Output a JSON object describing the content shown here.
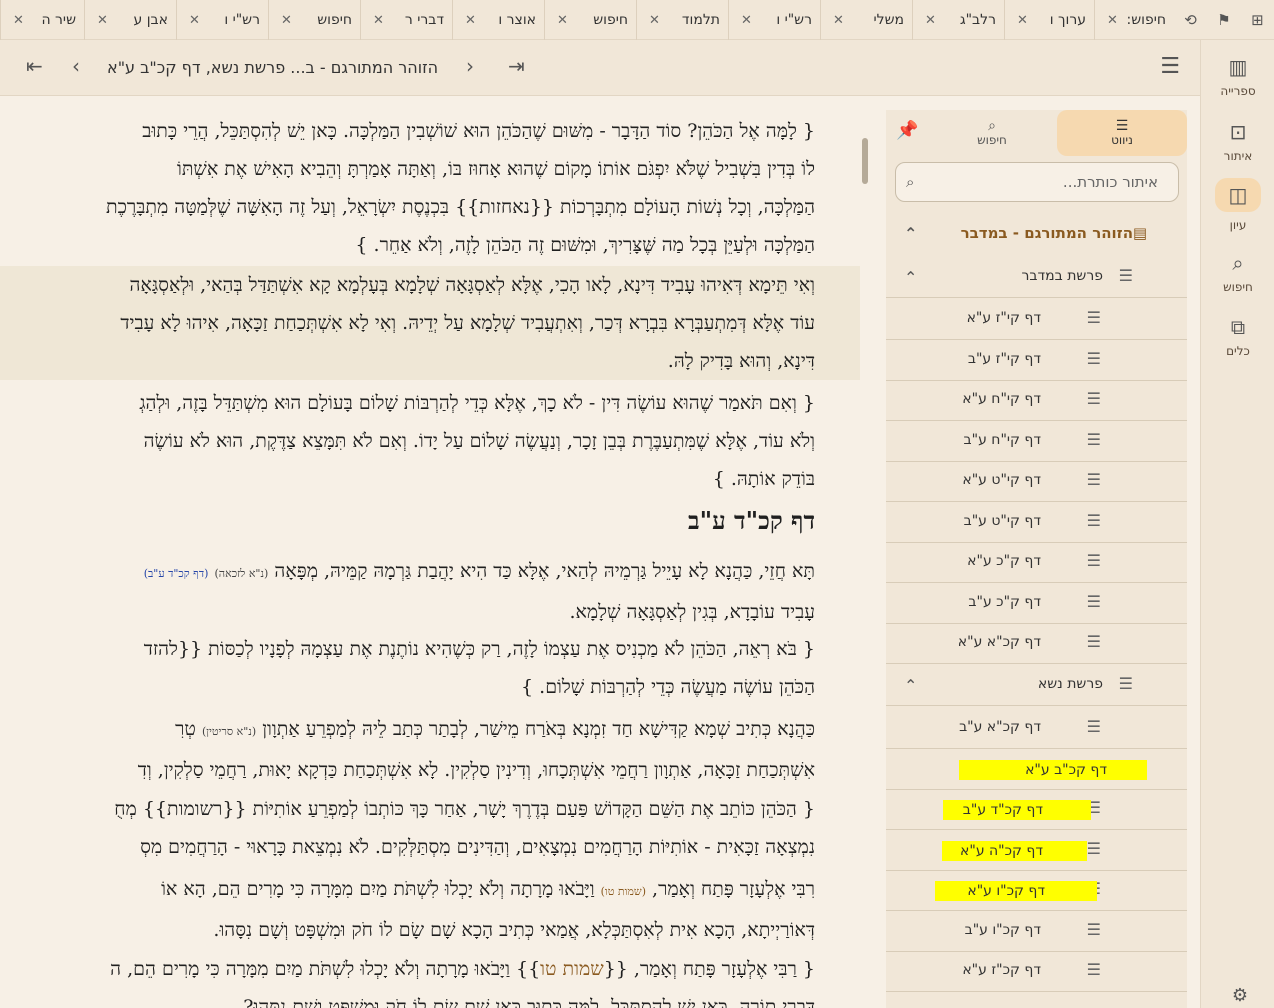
{
  "tabs": [
    {
      "label": "חיפוש:"
    },
    {
      "label": "ערוך ו"
    },
    {
      "label": "רלב\"ג"
    },
    {
      "label": "משלי"
    },
    {
      "label": "רש\"י ו"
    },
    {
      "label": "תלמוד"
    },
    {
      "label": "חיפוש"
    },
    {
      "label": "אוצר ו"
    },
    {
      "label": "דברי ר"
    },
    {
      "label": "חיפוש"
    },
    {
      "label": "רש\"י ו"
    },
    {
      "label": "אבן ע"
    },
    {
      "label": "שיר ה"
    }
  ],
  "rail": {
    "library": "ספרייה",
    "find": "איתור",
    "study": "עיון",
    "search": "חיפוש",
    "tools": "כלים"
  },
  "toolbar": {
    "title": "הזוהר המתורגם - ב... פרשת נשא, דף קכ\"ב ע\"א"
  },
  "panel": {
    "tab_nav": "ניווט",
    "tab_search": "חיפוש",
    "search_placeholder": "איתור כותרת...",
    "book": "הזוהר המתורגם - במדבר",
    "parasha1": "פרשת במדבר",
    "parasha2": "פרשת נשא",
    "items1": [
      "דף קי\"ז ע\"א",
      "דף קי\"ז ע\"ב",
      "דף קי\"ח ע\"א",
      "דף קי\"ח ע\"ב",
      "דף קי\"ט ע\"א",
      "דף קי\"ט ע\"ב",
      "דף ק\"כ ע\"א",
      "דף ק\"כ ע\"ב",
      "דף קכ\"א ע\"א"
    ],
    "items2": [
      "דף קכ\"א ע\"ב",
      "דף קכ\"ב ע\"א",
      "דף קכ\"ד ע\"ב",
      "דף קכ\"ה ע\"א",
      "דף קכ\"ו ע\"א",
      "דף קכ\"ו ע\"ב",
      "דף קכ\"ז ע\"א"
    ],
    "highlight_color": "#ffff00"
  },
  "content": {
    "p0": "{ לָמָּה אֶל הַכֹּהֵן? סוֹד הַדָּבָר - מִשּׁוּם שֶׁהַכֹּהֵן הוּא שׁוֹשְׁבִין הַמַּלְכָּה. כָּאן יֵשׁ לְהִסְתַּכֵּל, הֲרֵי כָּתוּב",
    "p1": "לוֹ בְּדִין בִּשְׁבִיל שֶׁלֹּא יִפְגֹּם אוֹתוֹ מָקוֹם שֶׁהוּא אָחוּז בּוֹ, וְאַתָּה אָמַרְתָּ וְהֵבִיא הָאִישׁ אֶת אִשְׁתּוֹ",
    "p2": "הַמַּלְכָּה, וְכָל נְשׁוֹת הָעוֹלָם מִתְבָּרְכוֹת {{נאחזות}} בִּכְנֶסֶת יִשְׂרָאֵל, וְעַל זֶה הָאִשָּׁה שֶׁלְּמַטָּה מִתְבָּרֶכֶת",
    "p3": "הַמַּלְכָּה וּלְעַיֵּן בְּכָל מַה שֶּׁצָּרִיךְ, וּמִשּׁוּם זֶה הַכֹּהֵן לָזֶה, וְלֹא אַחֵר. }",
    "h0": "וְאִי תֵּימָא דְּאִיהוּ עָבִיד דִּינָא, לָאו הָכִי, אֶלָּא לְאַסְגָּאָה שְׁלָמָא בְּעָלְמָא קָא אִשְׁתַּדַּל בְּהַאי, וּלְאַסְגָּאָה",
    "h1": "עוֹד אֶלָּא דְּמִתְעַבְּרָא בִּבְרָא דְּכַר, וְאִתְעֲבִיד שְׁלָמָא עַל יְדֵיהּ. וְאִי לָא אִשְׁתְּכַחַת זַכָּאָה, אִיהוּ לָא עָבִיד",
    "h2": "דִּינָא, וְהוּא בָּדִיק לָהּ.",
    "q0": "{ וְאִם תֹּאמַר שֶׁהוּא עוֹשֶׂה דִּין - לֹא כָךְ, אֶלָּא כְּדֵי לְהַרְבּוֹת שָׁלוֹם בָּעוֹלָם הוּא מִשְׁתַּדֵּל בָּזֶה, וּלְהַגְ",
    "q1": "וְלֹא עוֹד, אֶלָּא שֶׁמִּתְעַבֶּרֶת בְּבֵן זָכָר, וְנַעֲשֶׂה שָׁלוֹם עַל יָדוֹ. וְאִם לֹא תִּמָּצֵא צַדֶּקֶת, הוּא לֹא עוֹשֶׂה",
    "q2": "בּוֹדֵק אוֹתָהּ. }",
    "daf_heading": "דף קכ\"ד ע\"ב",
    "t0": "תָּא חֲזֵי, כַּהֲנָא לָא עָיֵיל גַּרְמֵיהּ לְהַאי, אֶלָּא כַּד הִיא יָהֲבַת גַּרְמָהּ קַמֵּיהּ, מְפָּאָה",
    "t0_note": "(נ\"א לזכאה)",
    "t0_ref": "(דף קכ\"ד ע\"ב)",
    "t1": "עָבִיד עוֹבָדָא, בְּגִין לְאַסְגָּאָה שְׁלָמָא.",
    "u0": "{ בֹּא רְאֵה, הַכֹּהֵן לֹא מַכְנִיס אֶת עַצְמוֹ לָזֶה, רַק כְּשֶׁהִיא נוֹתֶנֶת אֶת עַצְמָהּ לְפָנָיו לְכַסּוֹת {{להזד",
    "u1": "הַכֹּהֵן עוֹשֶׂה מַעֲשֶׂה כְּדֵי לְהַרְבּוֹת שָׁלוֹם. }",
    "v0": "כַּהֲנָא כְּתִיב שְׁמָא קַדִּישָׁא חַד זִמְנָא בְּאֹרַח מֵישַׁר, לְבָתַר כְּתַב לֵיהּ לְמַפְרֵעַ אַתְוָון",
    "v0_note": "(נ\"א סריטין)",
    "v0_end": "טְרִ",
    "v1": "אִשְׁתְּכַחַת זַכָּאָה, אַתְוָון רַחֲמֵי אִשְׁתְּכָחוּ, וְדִינִין סַלְקִין. לָא אִשְׁתְּכַחַת כַּדְקָא יָאוּת, רַחֲמֵי סַלְקִין, וְדִ",
    "w0": "{ הַכֹּהֵן כּוֹתֵב אֶת הַשֵּׁם הַקָּדוֹשׁ פַּעַם בְּדֶרֶךְ יָשָׁר, אַחַר כָּךְ כּוֹתְבוֹ לְמַפְרֵעַ אוֹתִיּוֹת {{רשומות}} מְחֻ",
    "w1": "נִמְצְאָה זַכָּאִית - אוֹתִיּוֹת הָרַחֲמִים נִמְצָאִים, וְהַדִּינִים מִסְתַּלְּקִים. לֹא נִמְצֵאת כָּרָאוּי - הָרַחֲמִים מִסְ",
    "x0": "רִבִּי אֶלְעָזָר פָּתַח וְאָמַר,",
    "x0_note": "(שמות טו)",
    "x0_end": "וַיָּבֹאוּ מָרָתָה וְלֹא יָכְלוּ לִשְׁתֹּת מַיִם מִמָּרָה כִּי מָרִים הֵם, הָא אוֹ",
    "x1": "דְּאוֹרַיְיתָא, הָכָא אִית לְאִסְתַּכְּלָא, אֲמַאי כְּתִיב הָכָא שָׁם שָׂם לוֹ חֹק וּמִשְׁפָּט וְשָׁם נִסָּהוּ.",
    "y0": "{ רַבִּי אֶלְעָזָר פָּתַח וְאָמַר, {{",
    "y0_src": "שמות טו",
    "y0_end": "}} וַיָּבֹאוּ מָרָתָה וְלֹא יָכְלוּ לִשְׁתֹּת מַיִם מִמָּרָה כִּי מָרִים הֵם, ה",
    "y1": "דִּבְרֵי תוֹרָה, כָּאן יֵשׁ לְהִסְתַּכֵּל, לָמָּה כָּתוּב כָּאן שָׁם שָׂם לוֹ חֹק וּמִשְׁפָּט וְשָׁם נִסָּהוּ?"
  }
}
